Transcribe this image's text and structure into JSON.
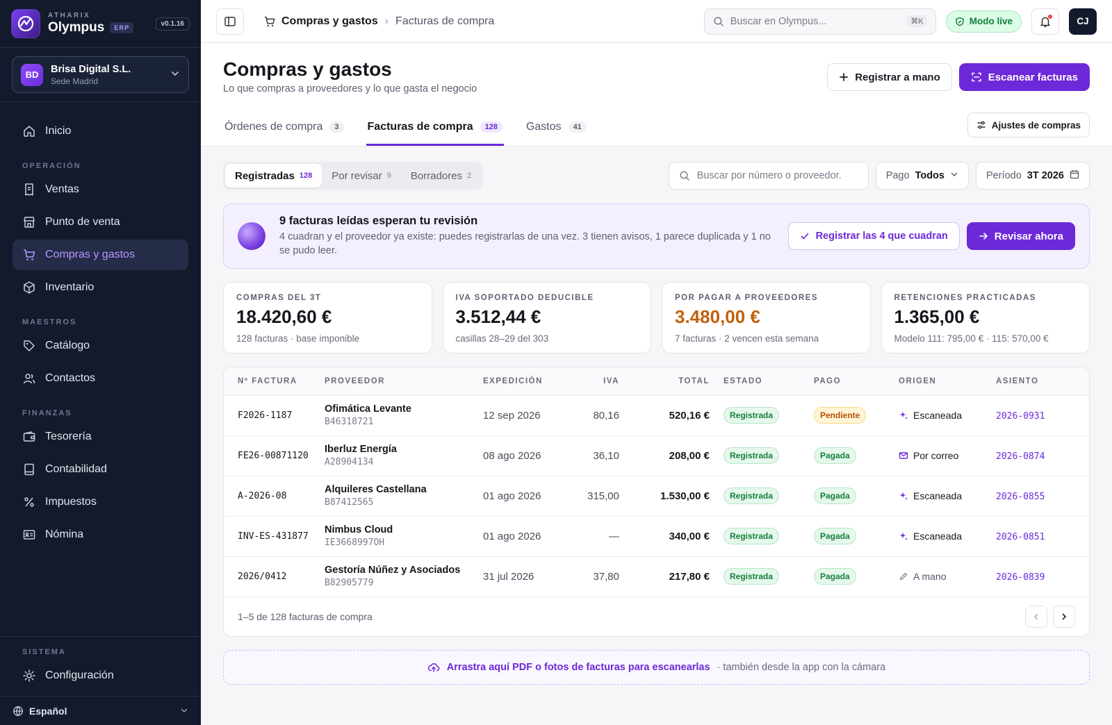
{
  "brand": {
    "company_small": "ATHARIX",
    "name": "Olympus",
    "badge": "ERP",
    "version": "v0.1.16"
  },
  "company": {
    "initials": "BD",
    "name": "Brisa Digital S.L.",
    "location": "Sede Madrid"
  },
  "sidebar": {
    "items": [
      {
        "label": "Inicio"
      }
    ],
    "sections": {
      "operacion": "OPERACIÓN",
      "maestros": "MAESTROS",
      "finanzas": "FINANZAS",
      "sistema": "SISTEMA"
    },
    "operacion_items": [
      "Ventas",
      "Punto de venta",
      "Compras y gastos",
      "Inventario"
    ],
    "maestros_items": [
      "Catálogo",
      "Contactos"
    ],
    "finanzas_items": [
      "Tesorería",
      "Contabilidad",
      "Impuestos",
      "Nómina"
    ],
    "sistema_items": [
      "Configuración"
    ],
    "language": "Español"
  },
  "topbar": {
    "breadcrumb_1": "Compras y gastos",
    "breadcrumb_2": "Facturas de compra",
    "search_placeholder": "Buscar en Olympus...",
    "search_shortcut": "⌘K",
    "live_label": "Modo live",
    "user_initials": "CJ"
  },
  "header": {
    "title": "Compras y gastos",
    "subtitle": "Lo que compras a proveedores y lo que gasta el negocio",
    "manual_button": "Registrar a mano",
    "scan_button": "Escanear facturas",
    "tabs": [
      {
        "label": "Órdenes de compra",
        "count": "3"
      },
      {
        "label": "Facturas de compra",
        "count": "128"
      },
      {
        "label": "Gastos",
        "count": "41"
      }
    ],
    "settings_button": "Ajustes de compras"
  },
  "filters": {
    "segments": [
      {
        "label": "Registradas",
        "count": "128"
      },
      {
        "label": "Por revisar",
        "count": "9"
      },
      {
        "label": "Borradores",
        "count": "2"
      }
    ],
    "search_placeholder": "Buscar por número o proveedor.",
    "payment_label": "Pago",
    "payment_value": "Todos",
    "period_label": "Período",
    "period_value": "3T 2026"
  },
  "banner": {
    "title": "9 facturas leídas esperan tu revisión",
    "description": "4 cuadran y el proveedor ya existe: puedes registrarlas de una vez. 3 tienen avisos, 1 parece duplicada y 1 no se pudo leer.",
    "register_button": "Registrar las 4 que cuadran",
    "review_button": "Revisar ahora"
  },
  "kpis": [
    {
      "label": "COMPRAS DEL 3T",
      "value": "18.420,60 €",
      "sub": "128 facturas · base imponible"
    },
    {
      "label": "IVA SOPORTADO DEDUCIBLE",
      "value": "3.512,44 €",
      "sub": "casillas 28–29 del 303"
    },
    {
      "label": "POR PAGAR A PROVEEDORES",
      "value": "3.480,00 €",
      "sub": "7 facturas · 2 vencen esta semana"
    },
    {
      "label": "RETENCIONES PRACTICADAS",
      "value": "1.365,00 €",
      "sub": "Modelo 111: 795,00 € · 115: 570,00 €"
    }
  ],
  "table": {
    "columns": [
      "Nº FACTURA",
      "PROVEEDOR",
      "EXPEDICIÓN",
      "IVA",
      "TOTAL",
      "ESTADO",
      "PAGO",
      "ORIGEN",
      "ASIENTO"
    ],
    "rows": [
      {
        "number": "F2026-1187",
        "supplier": "Ofimática Levante",
        "tax_id": "B46318721",
        "date": "12 sep 2026",
        "iva": "80,16",
        "total": "520,16 €",
        "status": "Registrada",
        "payment": "Pendiente",
        "origin": "Escaneada",
        "entry": "2026-0931"
      },
      {
        "number": "FE26-00871120",
        "supplier": "Iberluz Energía",
        "tax_id": "A28904134",
        "date": "08 ago 2026",
        "iva": "36,10",
        "total": "208,00 €",
        "status": "Registrada",
        "payment": "Pagada",
        "origin": "Por correo",
        "entry": "2026-0874"
      },
      {
        "number": "A-2026-08",
        "supplier": "Alquileres Castellana",
        "tax_id": "B87412565",
        "date": "01 ago 2026",
        "iva": "315,00",
        "total": "1.530,00 €",
        "status": "Registrada",
        "payment": "Pagada",
        "origin": "Escaneada",
        "entry": "2026-0855"
      },
      {
        "number": "INV-ES-431877",
        "supplier": "Nimbus Cloud",
        "tax_id": "IE3668997OH",
        "date": "01 ago 2026",
        "iva": "—",
        "total": "340,00 €",
        "status": "Registrada",
        "payment": "Pagada",
        "origin": "Escaneada",
        "entry": "2026-0851"
      },
      {
        "number": "2026/0412",
        "supplier": "Gestoría Núñez y Asociados",
        "tax_id": "B82905779",
        "date": "31 jul 2026",
        "iva": "37,80",
        "total": "217,80 €",
        "status": "Registrada",
        "payment": "Pagada",
        "origin": "A mano",
        "entry": "2026-0839"
      }
    ],
    "footer": "1–5 de 128 facturas de compra"
  },
  "dropzone": {
    "primary": "Arrastra aquí PDF o fotos de facturas para escanearlas",
    "secondary": "· también desde la app con la cámara"
  },
  "colors": {
    "accent": "#6d28d9",
    "sidebar_bg": "#131a2c",
    "warning": "#c2610c",
    "success": "#15803d"
  }
}
